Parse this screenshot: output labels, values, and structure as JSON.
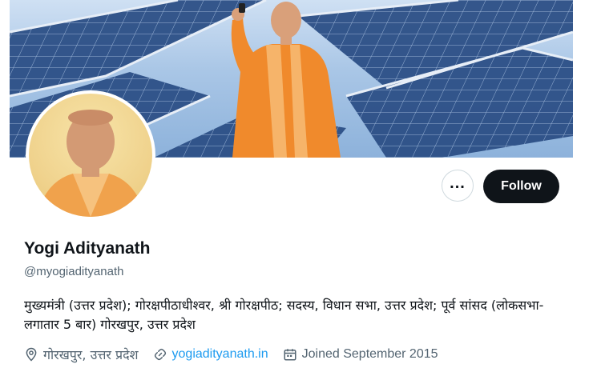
{
  "profile": {
    "name": "Yogi Adityanath",
    "handle": "@myogiadityanath",
    "bio": "मुख्यमंत्री (उत्तर प्रदेश); गोरक्षपीठाधीश्वर, श्री गोरक्षपीठ; सदस्य, विधान सभा, उत्तर प्रदेश; पूर्व सांसद (लोकसभा-लगातार 5 बार) गोरखपुर, उत्तर प्रदेश",
    "location": "गोरखपुर, उत्तर प्रदेश",
    "website": "yogiadityanath.in",
    "joined": "Joined September 2015"
  },
  "actions": {
    "more_label": "...",
    "follow_label": "Follow"
  },
  "icons": {
    "location": "location-pin-icon",
    "link": "link-icon",
    "calendar": "calendar-icon",
    "more": "more-options-icon"
  },
  "colors": {
    "follow_bg": "#0f1419",
    "link": "#1d9bf0",
    "secondary_text": "#536471"
  }
}
